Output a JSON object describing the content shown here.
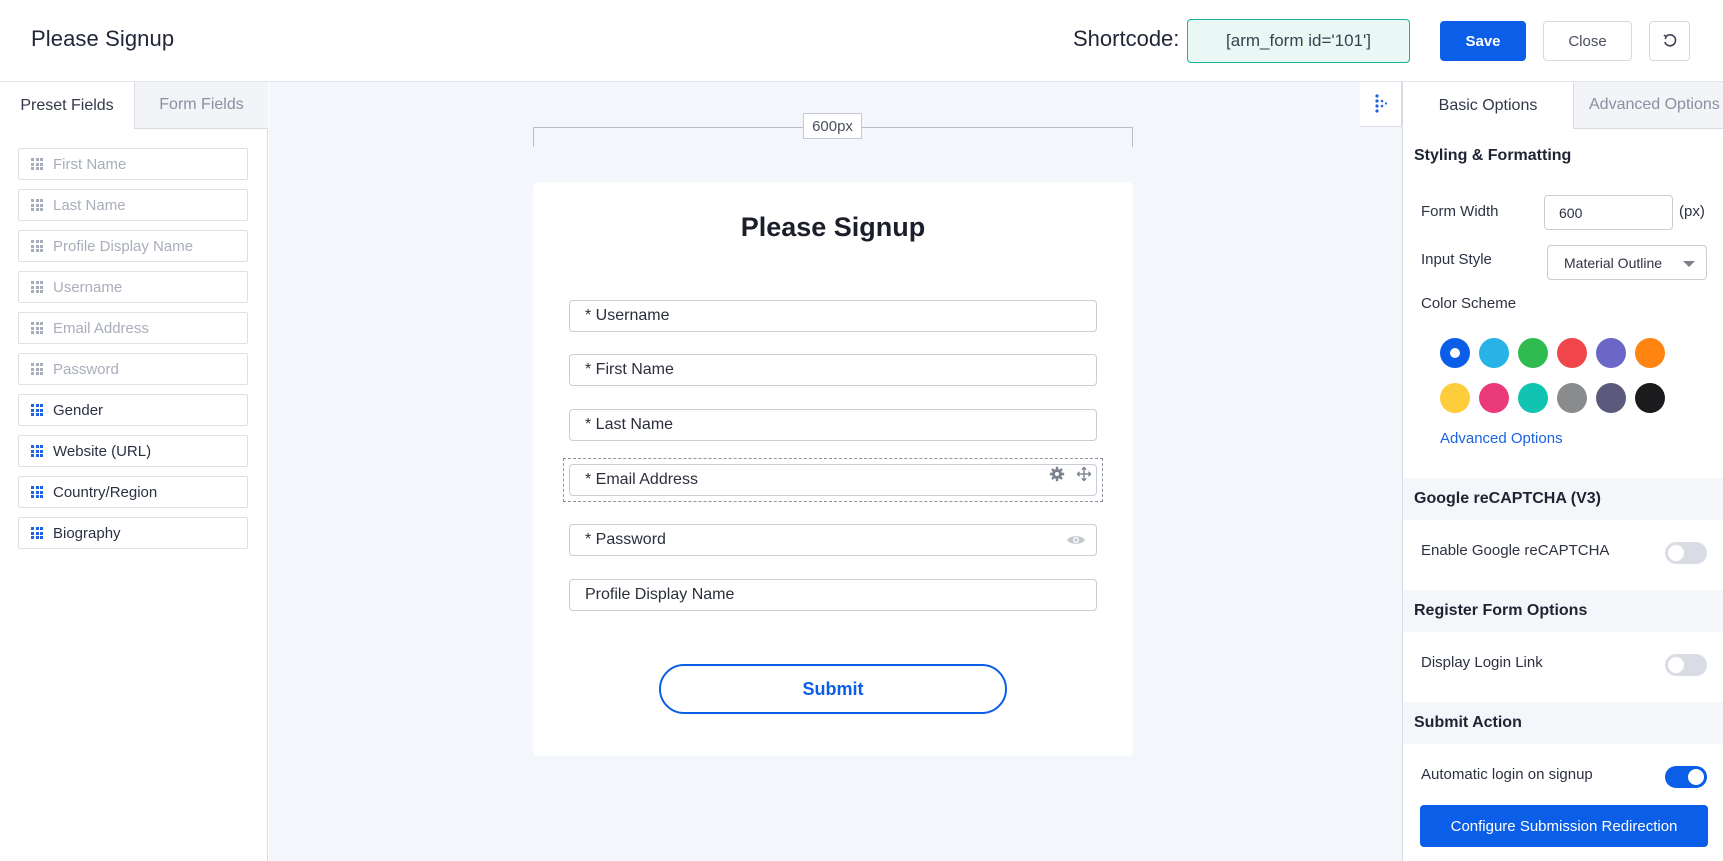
{
  "header": {
    "title": "Please Signup",
    "shortcode_label": "Shortcode:",
    "shortcode_value": "[arm_form id='101']",
    "save_label": "Save",
    "close_label": "Close",
    "reset_icon": "reset-icon"
  },
  "left_panel": {
    "tabs": [
      {
        "label": "Preset Fields",
        "active": true
      },
      {
        "label": "Form Fields",
        "active": false
      }
    ],
    "fields": [
      {
        "label": "First Name",
        "enabled": false
      },
      {
        "label": "Last Name",
        "enabled": false
      },
      {
        "label": "Profile Display Name",
        "enabled": false
      },
      {
        "label": "Username",
        "enabled": false
      },
      {
        "label": "Email Address",
        "enabled": false
      },
      {
        "label": "Password",
        "enabled": false
      },
      {
        "label": "Gender",
        "enabled": true
      },
      {
        "label": "Website (URL)",
        "enabled": true
      },
      {
        "label": "Country/Region",
        "enabled": true
      },
      {
        "label": "Biography",
        "enabled": true
      }
    ]
  },
  "canvas": {
    "ruler_label": "600px",
    "form_title": "Please Signup",
    "inputs": [
      {
        "label": "* Username"
      },
      {
        "label": "* First Name"
      },
      {
        "label": "* Last Name"
      },
      {
        "label": "* Email Address",
        "selected": true
      },
      {
        "label": "* Password",
        "has_eye": true
      },
      {
        "label": "Profile Display Name"
      }
    ],
    "submit_label": "Submit"
  },
  "right_panel": {
    "tabs": [
      {
        "label": "Basic Options",
        "active": true
      },
      {
        "label": "Advanced Options",
        "active": false
      }
    ],
    "styling": {
      "heading": "Styling & Formatting",
      "form_width_label": "Form Width",
      "form_width_value": "600",
      "form_width_unit": "(px)",
      "input_style_label": "Input Style",
      "input_style_value": "Material Outline",
      "color_scheme_label": "Color Scheme",
      "colors": [
        "#0a5ee8",
        "#27b3e6",
        "#2fbb4f",
        "#f0454a",
        "#6a67c9",
        "#ff8412",
        "#fdcd3b",
        "#ea3a79",
        "#10c4b1",
        "#8a8b8c",
        "#5b5a7c",
        "#1b1b1d"
      ],
      "selected_color_index": 0,
      "advanced_link": "Advanced Options"
    },
    "recaptcha": {
      "heading": "Google reCAPTCHA (V3)",
      "enable_label": "Enable Google reCAPTCHA",
      "enabled": false
    },
    "register_options": {
      "heading": "Register Form Options",
      "login_link_label": "Display Login Link",
      "enabled": false
    },
    "submit_action": {
      "heading": "Submit Action",
      "auto_login_label": "Automatic login on signup",
      "enabled": true,
      "config_button": "Configure Submission Redirection"
    }
  }
}
